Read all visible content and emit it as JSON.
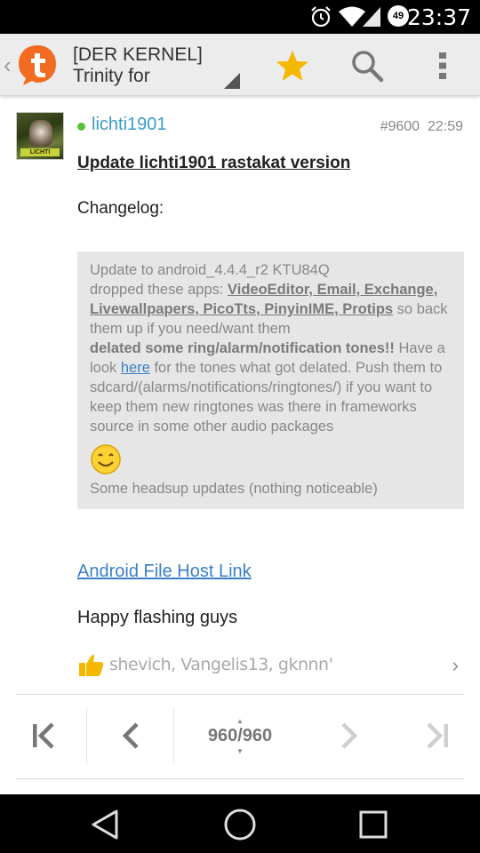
{
  "status_bar": {
    "time": "23:37",
    "battery_level": "49",
    "icons": [
      "alarm-icon",
      "wifi-icon",
      "signal-icon",
      "battery-icon"
    ]
  },
  "app_bar": {
    "title_line1": "[DER KERNEL]",
    "title_line2": "Trinity for",
    "logo_icon": "tapatalk-logo",
    "actions": [
      "star-icon",
      "search-icon",
      "overflow-menu-icon"
    ],
    "colors": {
      "logo": "#f26b21",
      "star": "#f5b800",
      "background": "#ececec"
    }
  },
  "post": {
    "username": "lichti1901",
    "post_number": "#9600",
    "time": "22:59",
    "avatar_tag": "LICHTI",
    "title": "Update lichti1901 rastakat version",
    "changelog_label": "Changelog:",
    "quote": {
      "line1": "Update to android_4.4.4_r2 KTU84Q",
      "dropped_prefix": "dropped these apps: ",
      "dropped_apps": "VideoEditor, Email, Exchange, Livewallpapers, PicoTts, PinyinIME, Protips",
      "dropped_suffix": " so back them up if you need/want them",
      "tones_bold": "delated some ring/alarm/notification tones!!",
      "tones_pre_link": " Have a look ",
      "tones_link": "here",
      "tones_post_link": " for the tones what got delated. Push them to sdcard/(alarms/notifications/ringtones/) if you want to keep them new ringtones was there in frameworks source in some other audio packages",
      "headsup": "Some headsup updates (nothing noticeable)"
    },
    "link_text": "Android File Host Link",
    "closing": "Happy flashing guys",
    "thanks": "shevich, Vangelis13, gknnn'"
  },
  "pager": {
    "current": "960",
    "total": "960",
    "separator": "/"
  },
  "nav_bar": {
    "buttons": [
      "back-icon",
      "home-icon",
      "recents-icon"
    ]
  }
}
